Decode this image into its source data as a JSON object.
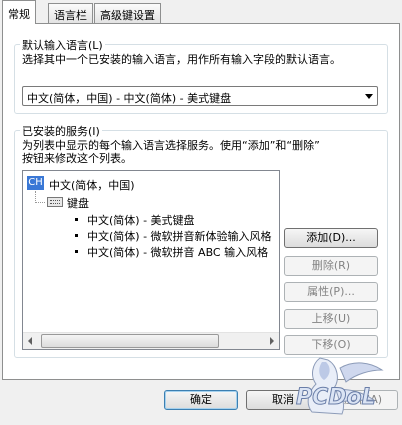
{
  "tabs": [
    {
      "label": "常规",
      "active": true
    },
    {
      "label": "语言栏",
      "active": false
    },
    {
      "label": "高级键设置",
      "active": false
    }
  ],
  "default_lang": {
    "title": "默认输入语言(L)",
    "description": "选择其中一个已安装的输入语言，用作所有输入字段的默认语言。",
    "selected": "中文(简体，中国) - 中文(简体) - 美式键盘"
  },
  "services": {
    "title": "已安装的服务(I)",
    "description_line1": "为列表中显示的每个输入语言选择服务。使用“添加”和“删除”",
    "description_line2": "按钮来修改这个列表。",
    "tree": {
      "language_badge": "CH",
      "language": "中文(简体，中国)",
      "category": "键盘",
      "items": [
        "中文(简体) - 美式键盘",
        "中文(简体) - 微软拼音新体验输入风格",
        "中文(简体) - 微软拼音 ABC 输入风格"
      ]
    }
  },
  "side_buttons": {
    "add": "添加(D)...",
    "remove": "删除(R)",
    "properties": "属性(P)...",
    "move_up": "上移(U)",
    "move_down": "下移(O)"
  },
  "footer": {
    "ok": "确定",
    "cancel": "取消",
    "apply": "应用(A)"
  },
  "watermark": "PCDoL",
  "colors": {
    "accent": "#3a78d6",
    "background": "#f0f0f0"
  }
}
